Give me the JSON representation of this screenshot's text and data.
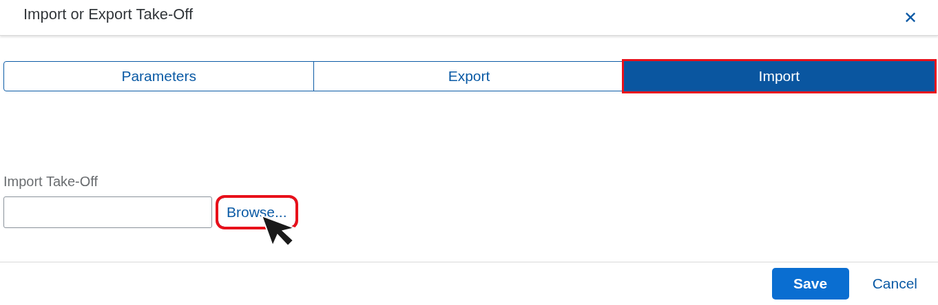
{
  "dialog": {
    "title": "Import or Export Take-Off",
    "close_label": "✕"
  },
  "tabs": [
    {
      "label": "Parameters",
      "selected": false,
      "highlighted": false
    },
    {
      "label": "Export",
      "selected": false,
      "highlighted": false
    },
    {
      "label": "Import",
      "selected": true,
      "highlighted": true
    }
  ],
  "import_field": {
    "label": "Import Take-Off",
    "browse_label": "Browse...",
    "browse_highlighted": true
  },
  "footer": {
    "buttons": [
      {
        "label": "Save",
        "kind": "primary"
      },
      {
        "label": "Cancel",
        "kind": "link"
      }
    ]
  }
}
